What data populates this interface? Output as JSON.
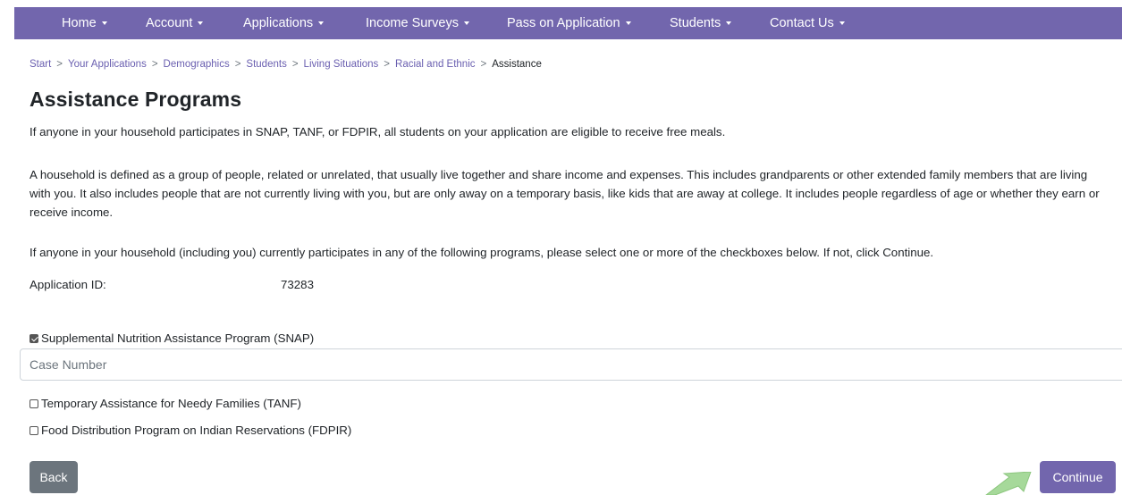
{
  "nav": {
    "home": "Home",
    "account": "Account",
    "applications": "Applications",
    "income_surveys": "Income Surveys",
    "pass_on_application": "Pass on Application",
    "students": "Students",
    "contact_us": "Contact Us"
  },
  "breadcrumb": {
    "start": "Start",
    "your_applications": "Your Applications",
    "demographics": "Demographics",
    "students": "Students",
    "living_situations": "Living Situations",
    "racial_and_ethnic": "Racial and Ethnic",
    "current": "Assistance",
    "separator": ">"
  },
  "page": {
    "title": "Assistance Programs",
    "intro": "If anyone in your household participates in SNAP, TANF, or FDPIR, all students on your application are eligible to receive free meals.",
    "household_definition": "A household is defined as a group of people, related or unrelated, that usually live together and share income and expenses. This includes grandparents or other extended family members that are living with you. It also includes people that are not currently living with you, but are only away on a temporary basis, like kids that are away at college. It includes people regardless of age or whether they earn or receive income.",
    "instructions": "If anyone in your household (including you) currently participates in any of the following programs, please select one or more of the checkboxes below. If not, click Continue.",
    "application_id_label": "Application ID:",
    "application_id_value": "73283"
  },
  "programs": {
    "snap": {
      "label": "Supplemental Nutrition Assistance Program (SNAP)",
      "checked": true
    },
    "case_number_placeholder": "Case Number",
    "case_number_value": "",
    "tanf": {
      "label": "Temporary Assistance for Needy Families (TANF)",
      "checked": false
    },
    "fdpir": {
      "label": "Food Distribution Program on Indian Reservations (FDPIR)",
      "checked": false
    }
  },
  "actions": {
    "back_label": "Back",
    "continue_label": "Continue"
  },
  "colors": {
    "navbar": "#7266ad",
    "link": "#6a5fb0",
    "back_button": "#6c757d",
    "continue_button": "#7266ad",
    "pointer_arrow": "#a6d99a"
  }
}
